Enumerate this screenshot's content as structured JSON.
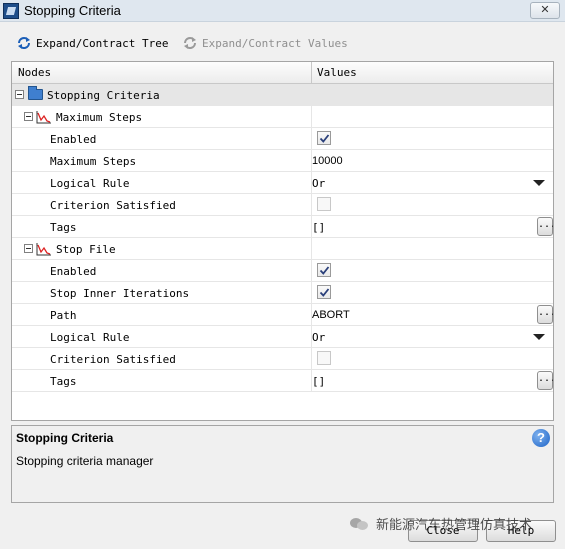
{
  "window": {
    "title": "Stopping Criteria",
    "close_glyph": "✕"
  },
  "toolbar": {
    "expand_tree_label": "Expand/Contract Tree",
    "expand_values_label": "Expand/Contract Values"
  },
  "columns": {
    "nodes": "Nodes",
    "values": "Values"
  },
  "tree": {
    "root": {
      "label": "Stopping Criteria"
    },
    "max_steps": {
      "label": "Maximum Steps",
      "enabled_label": "Enabled",
      "enabled": true,
      "max_steps_label": "Maximum Steps",
      "max_steps_value": "10000",
      "logical_rule_label": "Logical Rule",
      "logical_rule_value": "Or",
      "satisfied_label": "Criterion Satisfied",
      "satisfied": false,
      "tags_label": "Tags",
      "tags_value": "[]",
      "tags_button": "..."
    },
    "stop_file": {
      "label": "Stop File",
      "enabled_label": "Enabled",
      "enabled": true,
      "stop_inner_label": "Stop Inner Iterations",
      "stop_inner": true,
      "path_label": "Path",
      "path_value": "ABORT",
      "path_button": "...",
      "logical_rule_label": "Logical Rule",
      "logical_rule_value": "Or",
      "satisfied_label": "Criterion Satisfied",
      "satisfied": false,
      "tags_label": "Tags",
      "tags_value": "[]",
      "tags_button": "..."
    }
  },
  "description": {
    "title": "Stopping Criteria",
    "body": "Stopping criteria manager",
    "help_glyph": "?"
  },
  "buttons": {
    "close": "Close",
    "help": "Help"
  },
  "watermark": {
    "text": "新能源汽车热管理仿真技术"
  },
  "icons": {
    "refresh": "refresh-icon",
    "folder": "folder-icon",
    "plot": "plot-icon",
    "help": "help-icon"
  },
  "colors": {
    "accent": "#1d63c6",
    "selected_row": "#e6e6e6"
  }
}
